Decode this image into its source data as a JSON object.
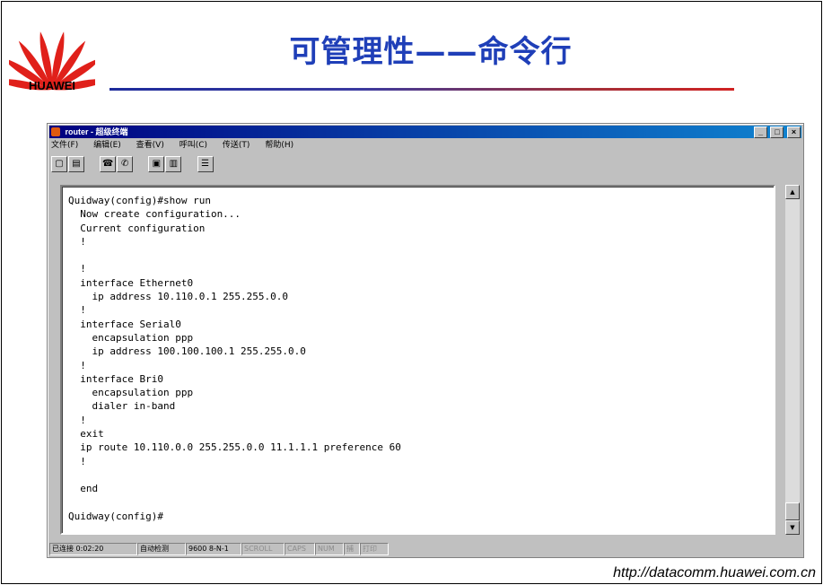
{
  "brand": {
    "name": "HUAWEI",
    "logo_color": "#e0201a"
  },
  "slide": {
    "title": "可管理性——命令行",
    "footer_url": "http://datacomm.huawei.com.cn"
  },
  "window": {
    "title": "router - 超级终端",
    "controls": {
      "minimize": "_",
      "restore": "□",
      "close": "×"
    },
    "menu": [
      "文件(F)",
      "编辑(E)",
      "查看(V)",
      "呼叫(C)",
      "传送(T)",
      "帮助(H)"
    ],
    "toolbar_icons": [
      "new-icon",
      "open-icon",
      "connect-icon",
      "disconnect-icon",
      "send-icon",
      "receive-icon",
      "properties-icon"
    ]
  },
  "terminal": {
    "lines": [
      "Quidway(config)#show run",
      "  Now create configuration...",
      "  Current configuration",
      "  !",
      "",
      "  !",
      "  interface Ethernet0",
      "    ip address 10.110.0.1 255.255.0.0",
      "  !",
      "  interface Serial0",
      "    encapsulation ppp",
      "    ip address 100.100.100.1 255.255.0.0",
      "  !",
      "  interface Bri0",
      "    encapsulation ppp",
      "    dialer in-band",
      "  !",
      "  exit",
      "  ip route 10.110.0.0 255.255.0.0 11.1.1.1 preference 60",
      "  !",
      "",
      "  end",
      "",
      "Quidway(config)#"
    ]
  },
  "statusbar": {
    "connected": "已连接 0:02:20",
    "detect": "自动检测",
    "settings": "9600 8-N-1",
    "scroll": "SCROLL",
    "caps": "CAPS",
    "num": "NUM",
    "capture": "捕",
    "print": "打印"
  }
}
